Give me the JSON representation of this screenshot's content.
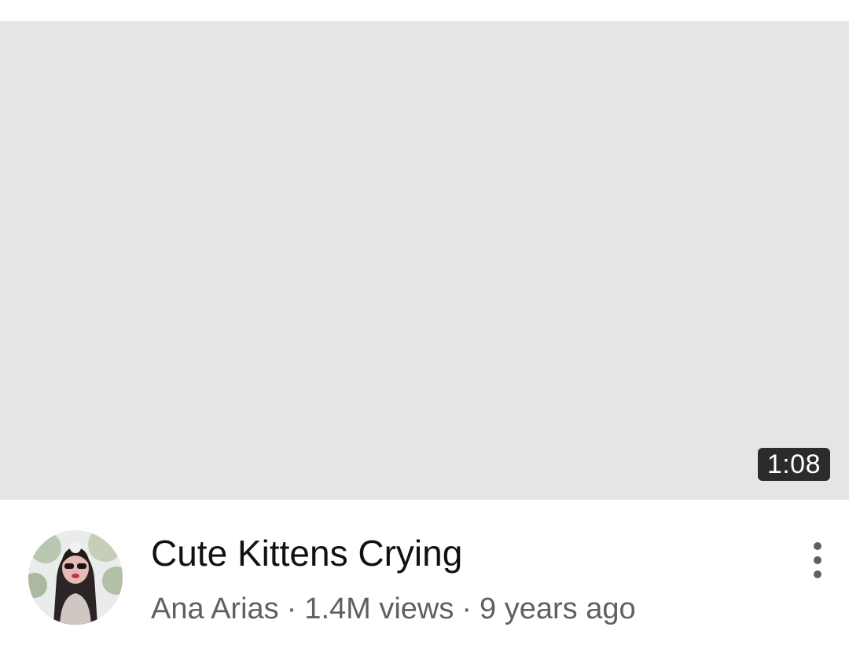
{
  "video": {
    "duration": "1:08",
    "title": "Cute Kittens Crying",
    "channel": "Ana Arias",
    "views": "1.4M views",
    "age": "9 years ago",
    "separator": "·"
  },
  "icons": {
    "menu": "more-vert-icon",
    "avatar": "channel-avatar"
  },
  "colors": {
    "thumbnail_placeholder": "#e5e5e5",
    "duration_badge_bg": "#2b2b2b",
    "title_text": "#111111",
    "meta_text": "#606060"
  }
}
